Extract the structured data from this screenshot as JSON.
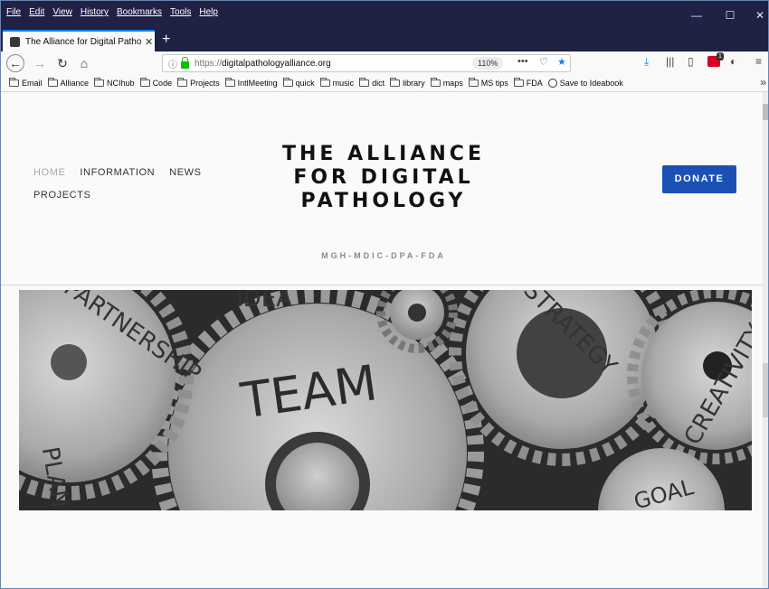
{
  "browser": {
    "menu": [
      "File",
      "Edit",
      "View",
      "History",
      "Bookmarks",
      "Tools",
      "Help"
    ],
    "window_controls": {
      "minimize": "—",
      "maximize": "☐",
      "close": "✕"
    },
    "tab": {
      "title": "The Alliance for Digital Patholo",
      "close": "✕",
      "new_tab": "+"
    },
    "url": {
      "scheme": "https://",
      "host": "digitalpathologyalliance.org",
      "zoom": "110%"
    },
    "bookmarks": [
      "Email",
      "Alliance",
      "NCIhub",
      "Code",
      "Projects",
      "IntlMeeting",
      "quick",
      "music",
      "dict",
      "library",
      "maps",
      "MS tips",
      "FDA"
    ],
    "ideabook": "Save to Ideabook",
    "bookmarks_more": "»",
    "addon_badge": "1"
  },
  "site": {
    "nav": {
      "home": "HOME",
      "information": "INFORMATION",
      "news": "NEWS",
      "projects": "PROJECTS"
    },
    "brand_lines": [
      "THE ALLIANCE",
      "FOR DIGITAL",
      "PATHOLOGY"
    ],
    "tagline": "MGH-MDIC-DPA-FDA",
    "donate": "DONATE"
  },
  "banner": {
    "words": [
      "PARTNERSHIP",
      "IDEA",
      "STRATEGY",
      "CREATIVITY",
      "TEAM",
      "PLAN",
      "GOAL"
    ]
  },
  "colors": {
    "titlebar": "#1f2145",
    "accent_tab": "#0a84ff",
    "donate_bg": "#1b51b4",
    "lock": "#12bc00",
    "bookmark_star": "#0a84ff"
  }
}
